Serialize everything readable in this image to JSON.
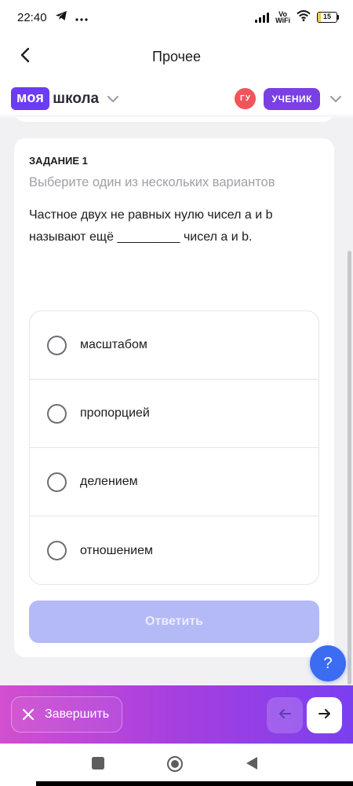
{
  "status_bar": {
    "time": "22:40",
    "network_label_top": "Vo",
    "network_label_bottom": "WiFi",
    "battery": "15",
    "battery_fraction": 0.15
  },
  "nav": {
    "title": "Прочее"
  },
  "header": {
    "logo_part1": "моя",
    "logo_part2": "школа",
    "avatar_initials": "ГУ",
    "role": "УЧЕНИК"
  },
  "task": {
    "label": "ЗАДАНИЕ 1",
    "hint": "Выберите один из нескольких вариантов",
    "question": "Частное двух не равных нулю чисел a и b называют ещё _________ чисел a и b.",
    "options": [
      {
        "label": "масштабом"
      },
      {
        "label": "пропорцией"
      },
      {
        "label": "делением"
      },
      {
        "label": "отношением"
      }
    ],
    "answer_button": "Ответить"
  },
  "help_button": "?",
  "bottom_bar": {
    "finish_label": "Завершить"
  },
  "colors": {
    "brand": "#6b3cf2",
    "role_badge": "#7b3fe4",
    "avatar": "#f2545b",
    "answer_disabled": "#b4baf6",
    "help": "#3b6cf2",
    "bar_gradient_start": "#d24fcf",
    "bar_gradient_end": "#7b3ff0"
  },
  "icons": {
    "back": "chevron-left-icon",
    "logo_dropdown": "chevron-down-icon",
    "role_dropdown": "chevron-down-icon",
    "finish": "close-icon",
    "prev": "arrow-left-icon",
    "next": "arrow-right-icon",
    "telegram": "telegram-icon",
    "more": "more-dots-icon",
    "wifi": "wifi-icon",
    "signal": "signal-icon",
    "battery": "battery-icon",
    "sys_recent": "square-icon",
    "sys_home": "circle-icon",
    "sys_back": "triangle-back-icon"
  }
}
